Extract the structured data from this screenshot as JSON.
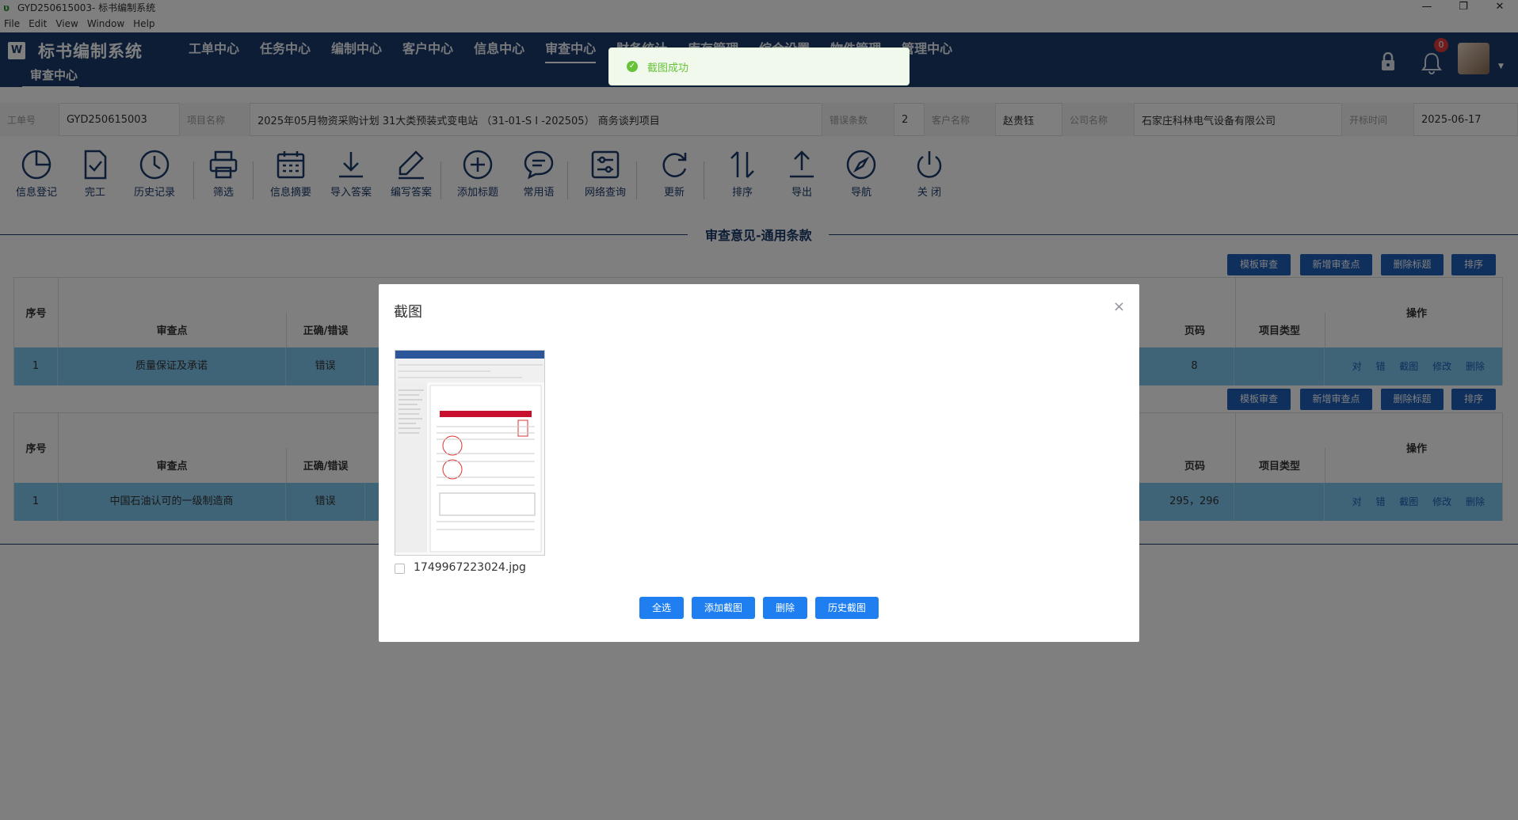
{
  "window": {
    "title": "GYD250615003- 标书编制系统",
    "controls": {
      "minimize": "—",
      "restore": "❐",
      "close": "✕"
    }
  },
  "menubar": [
    "File",
    "Edit",
    "View",
    "Window",
    "Help"
  ],
  "nav": {
    "brand": "标书编制系统",
    "items": [
      "工单中心",
      "任务中心",
      "编制中心",
      "客户中心",
      "信息中心",
      "审查中心",
      "财务统计",
      "库存管理",
      "综合设置",
      "物件管理",
      "管理中心"
    ],
    "active_item": "审查中心",
    "sub_item": "审查中心",
    "notification_count": "0"
  },
  "toast": {
    "message": "截图成功",
    "check": "✓"
  },
  "info": {
    "order_label": "工单号",
    "order_value": "GYD250615003",
    "project_label": "项目名称",
    "project_value": "2025年05月物资采购计划 31大类预装式变电站 （31-01-S I -202505） 商务谈判项目",
    "error_label": "错误条数",
    "error_value": "2",
    "client_label": "客户名称",
    "client_value": "赵贵钰",
    "company_label": "公司名称",
    "company_value": "石家庄科林电气设备有限公司",
    "date_label": "开标时间",
    "date_value": "2025-06-17"
  },
  "toolbar": [
    "信息登记",
    "完工",
    "历史记录",
    "筛选",
    "信息摘要",
    "导入答案",
    "编写答案",
    "添加标题",
    "常用语",
    "网络查询",
    "更新",
    "排序",
    "导出",
    "导航",
    "关 闭"
  ],
  "section_title": "审查意见-通用条款",
  "table_buttons": [
    "模板审查",
    "新增审查点",
    "删除标题",
    "排序"
  ],
  "table_headers": {
    "index": "序号",
    "point": "审查点",
    "correct": "正确/错误",
    "page": "页码",
    "type": "项目类型",
    "ops": "操作"
  },
  "rows": [
    {
      "index": "1",
      "point": "质量保证及承诺",
      "correct": "错误",
      "page": "8",
      "type": ""
    },
    {
      "index": "1",
      "point": "中国石油认可的一级制造商",
      "correct": "错误",
      "page": "295，296",
      "type": ""
    }
  ],
  "row_ops": [
    "对",
    "错",
    "截图",
    "修改",
    "删除"
  ],
  "dialog": {
    "title": "截图",
    "close": "×",
    "file_name": "1749967223024.jpg",
    "buttons": {
      "select_all": "全选",
      "add": "添加截图",
      "delete": "删除",
      "history": "历史截图"
    }
  },
  "colors": {
    "nav": "#1b3a6b",
    "row_highlight": "#7fc6ee",
    "primary": "#1f7ff0",
    "success": "#67c23a"
  }
}
